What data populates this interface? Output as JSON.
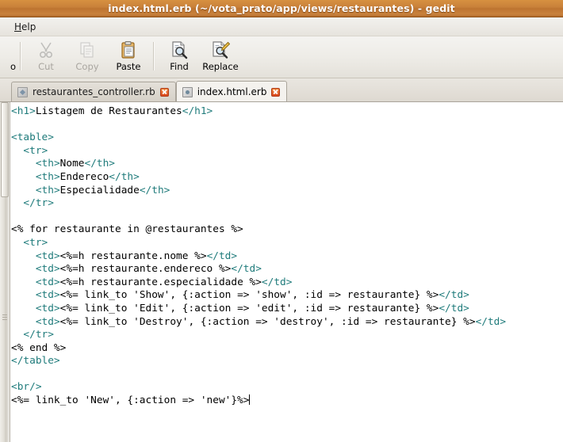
{
  "window": {
    "title": "index.html.erb (~/vota_prato/app/views/restaurantes) - gedit",
    "title_colors": {
      "bar_start": "#d79140",
      "bar_end": "#b26a2a",
      "text": "#ffffff"
    }
  },
  "menubar": {
    "items": [
      {
        "name": "help",
        "mnemonic": "H",
        "rest": "elp"
      }
    ]
  },
  "toolbar": {
    "clipped_left_label": "o",
    "buttons": [
      {
        "name": "cut",
        "label": "Cut",
        "icon": "scissors-icon",
        "enabled": false
      },
      {
        "name": "copy",
        "label": "Copy",
        "icon": "copy-icon",
        "enabled": false
      },
      {
        "name": "paste",
        "label": "Paste",
        "icon": "clipboard-icon",
        "enabled": true
      },
      {
        "name": "find",
        "label": "Find",
        "icon": "find-icon",
        "enabled": true
      },
      {
        "name": "replace",
        "label": "Replace",
        "icon": "replace-icon",
        "enabled": true
      }
    ]
  },
  "tabs": [
    {
      "label": "restaurantes_controller.rb",
      "icon": "ruby-file-icon",
      "active": false,
      "close": "close-icon"
    },
    {
      "label": "index.html.erb",
      "icon": "html-file-icon",
      "active": true,
      "close": "close-icon"
    }
  ],
  "editor": {
    "syntax_colors": {
      "tag": "#1f7b7b",
      "text": "#000000",
      "background": "#ffffff"
    },
    "lines": [
      [
        {
          "t": "tag",
          "v": "<h1>"
        },
        {
          "t": "plain",
          "v": "Listagem de Restaurantes"
        },
        {
          "t": "tag",
          "v": "</h1>"
        }
      ],
      [],
      [
        {
          "t": "tag",
          "v": "<table>"
        }
      ],
      [
        {
          "t": "plain",
          "v": "  "
        },
        {
          "t": "tag",
          "v": "<tr>"
        }
      ],
      [
        {
          "t": "plain",
          "v": "    "
        },
        {
          "t": "tag",
          "v": "<th>"
        },
        {
          "t": "plain",
          "v": "Nome"
        },
        {
          "t": "tag",
          "v": "</th>"
        }
      ],
      [
        {
          "t": "plain",
          "v": "    "
        },
        {
          "t": "tag",
          "v": "<th>"
        },
        {
          "t": "plain",
          "v": "Endereco"
        },
        {
          "t": "tag",
          "v": "</th>"
        }
      ],
      [
        {
          "t": "plain",
          "v": "    "
        },
        {
          "t": "tag",
          "v": "<th>"
        },
        {
          "t": "plain",
          "v": "Especialidade"
        },
        {
          "t": "tag",
          "v": "</th>"
        }
      ],
      [
        {
          "t": "plain",
          "v": "  "
        },
        {
          "t": "tag",
          "v": "</tr>"
        }
      ],
      [],
      [
        {
          "t": "plain",
          "v": "<% for restaurante in @restaurantes %>"
        }
      ],
      [
        {
          "t": "plain",
          "v": "  "
        },
        {
          "t": "tag",
          "v": "<tr>"
        }
      ],
      [
        {
          "t": "plain",
          "v": "    "
        },
        {
          "t": "tag",
          "v": "<td>"
        },
        {
          "t": "plain",
          "v": "<%=h restaurante.nome %>"
        },
        {
          "t": "tag",
          "v": "</td>"
        }
      ],
      [
        {
          "t": "plain",
          "v": "    "
        },
        {
          "t": "tag",
          "v": "<td>"
        },
        {
          "t": "plain",
          "v": "<%=h restaurante.endereco %>"
        },
        {
          "t": "tag",
          "v": "</td>"
        }
      ],
      [
        {
          "t": "plain",
          "v": "    "
        },
        {
          "t": "tag",
          "v": "<td>"
        },
        {
          "t": "plain",
          "v": "<%=h restaurante.especialidade %>"
        },
        {
          "t": "tag",
          "v": "</td>"
        }
      ],
      [
        {
          "t": "plain",
          "v": "    "
        },
        {
          "t": "tag",
          "v": "<td>"
        },
        {
          "t": "plain",
          "v": "<%= link_to 'Show', {:action => 'show', :id => restaurante} %>"
        },
        {
          "t": "tag",
          "v": "</td>"
        }
      ],
      [
        {
          "t": "plain",
          "v": "    "
        },
        {
          "t": "tag",
          "v": "<td>"
        },
        {
          "t": "plain",
          "v": "<%= link_to 'Edit', {:action => 'edit', :id => restaurante} %>"
        },
        {
          "t": "tag",
          "v": "</td>"
        }
      ],
      [
        {
          "t": "plain",
          "v": "    "
        },
        {
          "t": "tag",
          "v": "<td>"
        },
        {
          "t": "plain",
          "v": "<%= link_to 'Destroy', {:action => 'destroy', :id => restaurante} %>"
        },
        {
          "t": "tag",
          "v": "</td>"
        }
      ],
      [
        {
          "t": "plain",
          "v": "  "
        },
        {
          "t": "tag",
          "v": "</tr>"
        }
      ],
      [
        {
          "t": "plain",
          "v": "<% end %>"
        }
      ],
      [
        {
          "t": "tag",
          "v": "</table>"
        }
      ],
      [],
      [
        {
          "t": "tag",
          "v": "<br/>"
        }
      ],
      [
        {
          "t": "plain",
          "v": "<%= link_to 'New', {:action => 'new'}%>"
        },
        {
          "t": "caret",
          "v": ""
        }
      ]
    ]
  }
}
